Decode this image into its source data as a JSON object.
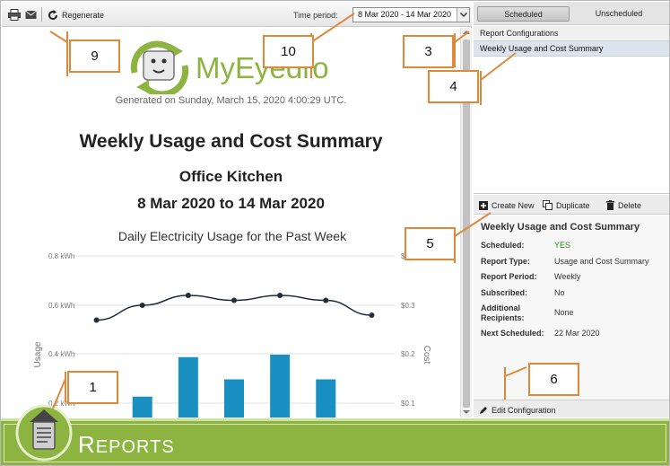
{
  "toolbar": {
    "print_icon": "printer-icon",
    "email_icon": "envelope-icon",
    "regenerate_icon": "refresh-icon",
    "regenerate_label": "Regenerate",
    "period_label": "Time period:",
    "period_value": "8 Mar 2020 - 14 Mar 2020"
  },
  "report": {
    "logo_text": "MyEyedro",
    "generated": "Generated on Sunday, March 15, 2020 4:00:29 UTC.",
    "title": "Weekly Usage and Cost Summary",
    "location": "Office Kitchen",
    "range": "8 Mar 2020 to 14 Mar 2020"
  },
  "chart_data": {
    "type": "bar",
    "title": "Daily Electricity Usage for the Past Week",
    "ylabel": "Usage",
    "y2label": "Cost",
    "y_ticks": [
      "0.8 kWh",
      "0.6 kWh",
      "0.4 kWh",
      "0.2 kWh"
    ],
    "y2_ticks": [
      "$",
      "$0.3",
      "$0.2",
      "$0.1"
    ],
    "ylim": [
      0,
      0.8
    ],
    "y2lim": [
      0,
      0.4
    ],
    "grid": true,
    "series": [
      {
        "kind": "line",
        "axis": "cost",
        "values": [
          0.27,
          0.3,
          0.32,
          0.31,
          0.32,
          0.31,
          0.28
        ]
      },
      {
        "kind": "bar",
        "axis": "usage",
        "values": [
          0,
          0.23,
          0.39,
          0.3,
          0.4,
          0.3,
          0
        ]
      }
    ],
    "colors": {
      "bar": "#1a8fc1",
      "line": "#1f2d3d"
    }
  },
  "right": {
    "tab_scheduled": "Scheduled",
    "tab_unscheduled": "Unscheduled",
    "config_header": "Report Configurations",
    "config_item": "Weekly Usage and Cost Summary",
    "create_label": "Create New",
    "duplicate_label": "Duplicate",
    "delete_label": "Delete",
    "details": {
      "title": "Weekly Usage and Cost Summary",
      "rows": [
        {
          "key": "Scheduled:",
          "value": "YES"
        },
        {
          "key": "Report Type:",
          "value": "Usage and Cost Summary"
        },
        {
          "key": "Report Period:",
          "value": "Weekly"
        },
        {
          "key": "Subscribed:",
          "value": "No"
        },
        {
          "key": "Additional Recipients:",
          "value": "None"
        },
        {
          "key": "Next Scheduled:",
          "value": "22 Mar 2020"
        }
      ],
      "yes_color": "#2a8a1f"
    },
    "edit_label": "Edit Configuration"
  },
  "footer": {
    "title_first": "R",
    "title_rest": "EPORTS",
    "badge_icon": "document-icon"
  },
  "callouts": [
    "1",
    "3",
    "4",
    "5",
    "6",
    "9",
    "10"
  ],
  "colors": {
    "accent": "#8db441",
    "callout_border": "#e0883a",
    "selected_row": "#dbe3ec"
  }
}
